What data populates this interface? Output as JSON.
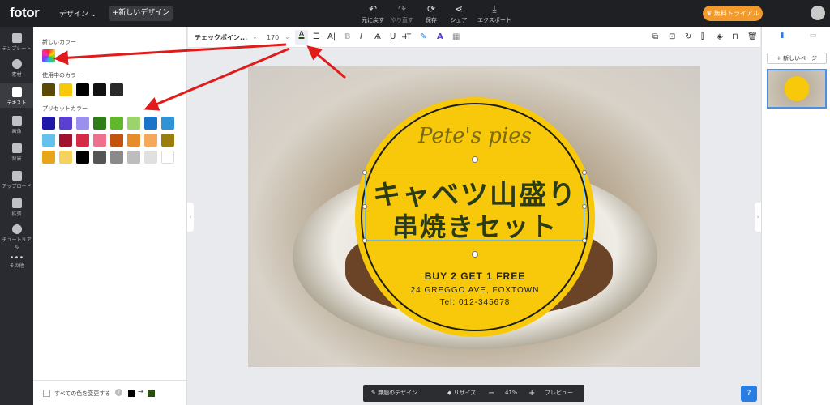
{
  "topbar": {
    "logo": "fotor",
    "design_menu": "デザイン ⌄",
    "new_design": "+新しいデザイン",
    "actions": [
      {
        "icon": "undo-icon",
        "label": "元に戻す"
      },
      {
        "icon": "redo-icon",
        "label": "やり直す"
      },
      {
        "icon": "save-icon",
        "label": "保存"
      },
      {
        "icon": "share-icon",
        "label": "シェア"
      },
      {
        "icon": "export-icon",
        "label": "エクスポート"
      }
    ],
    "trial": "無料トライアル"
  },
  "rail": [
    {
      "icon": "template-icon",
      "label": "テンプレート"
    },
    {
      "icon": "element-icon",
      "label": "素材"
    },
    {
      "icon": "text-icon",
      "label": "テキスト"
    },
    {
      "icon": "image-icon",
      "label": "画像"
    },
    {
      "icon": "background-icon",
      "label": "背景"
    },
    {
      "icon": "upload-icon",
      "label": "アップロード"
    },
    {
      "icon": "apps-icon",
      "label": "拡張"
    },
    {
      "icon": "tutorial-icon",
      "label": "チュートリアル"
    },
    {
      "icon": "more-icon",
      "label": "その他"
    }
  ],
  "panel": {
    "new_color_title": "新しいカラー",
    "in_use_title": "使用中のカラー",
    "in_use": [
      "#5a4a06",
      "#f7c90a",
      "#000000",
      "#111111",
      "#2a2a2a"
    ],
    "preset_title": "プリセットカラー",
    "preset": [
      "#1f17a8",
      "#5b3fd0",
      "#9b8ff0",
      "#2f7d1a",
      "#62b82d",
      "#9bd46b",
      "#1a74c7",
      "#2f93d6",
      "#63c1ee",
      "#a1122e",
      "#d42b47",
      "#ee6f8e",
      "#c2520c",
      "#e88b2a",
      "#f5a85a",
      "#9b7d0e",
      "#e6a617",
      "#f5d25b",
      "#000000",
      "#555555",
      "#8a8a8a",
      "#bdbdbd",
      "#e0e0e0",
      "#ffffff"
    ],
    "change_all": "すべての色を変更する"
  },
  "text_toolbar": {
    "font": "チェックポイン...",
    "size": "170"
  },
  "design": {
    "pete": "Pete's pies",
    "jp_line1": "キャベツ山盛り",
    "jp_line2": "串焼きセット",
    "buy": "BUY 2 GET 1 FREE",
    "addr": "24 GREGGO AVE, FOXTOWN",
    "tel": "Tel: 012-345678"
  },
  "bottombar": {
    "name": "無題のデザイン",
    "resize": "リサイズ",
    "zoom": "41%",
    "preview": "プレビュー"
  },
  "right": {
    "add_page": "+ 新しいページ"
  },
  "colors": {
    "accent": "#2a7de1",
    "trial": "#f39a2d",
    "badge": "#f7c90a",
    "text_green": "#2b3a17"
  }
}
